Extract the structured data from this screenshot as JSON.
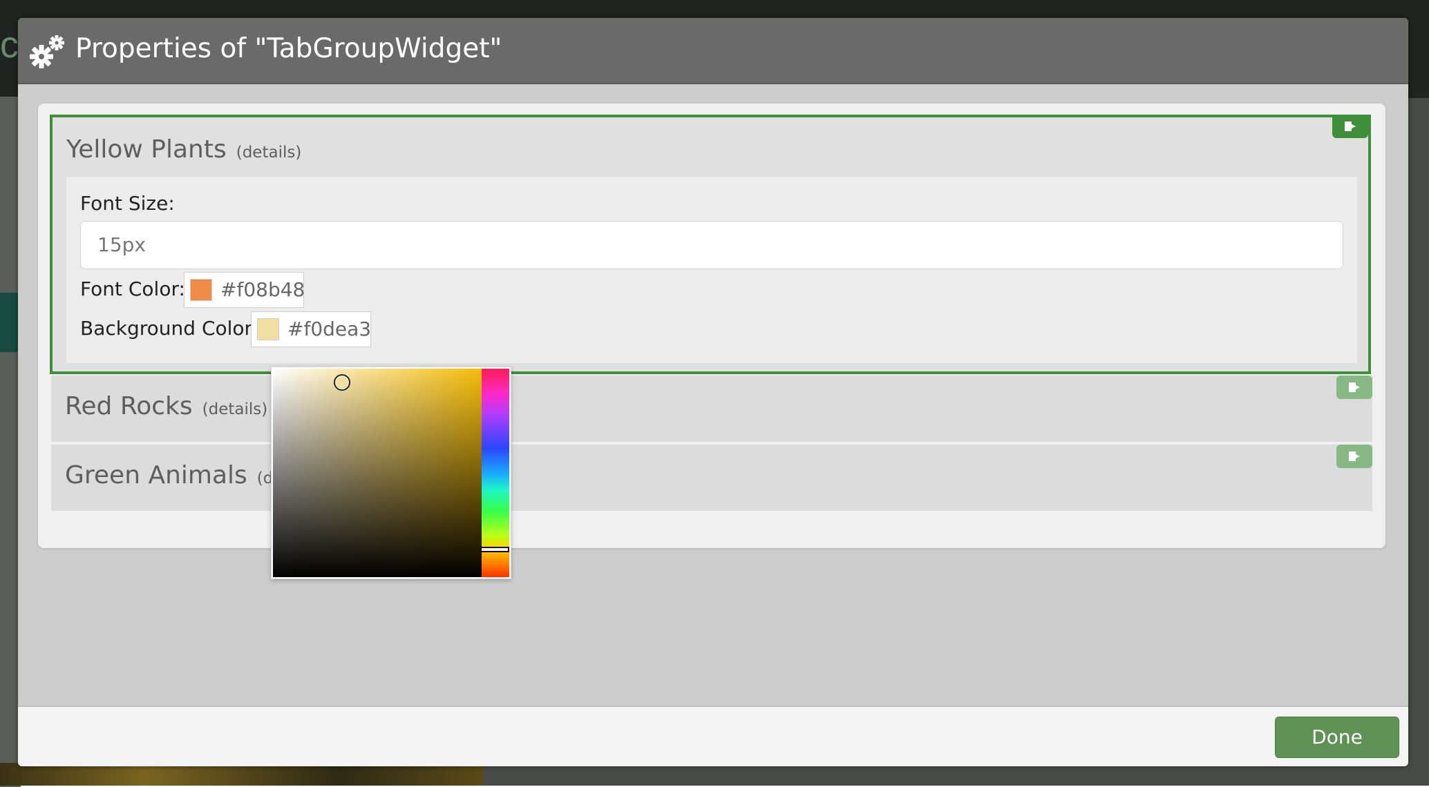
{
  "dialog": {
    "title": "Properties of \"TabGroupWidget\"",
    "icon": "gears-icon"
  },
  "tabs": [
    {
      "title": "Yellow Plants",
      "details_label": "(details)",
      "expanded": true,
      "properties": {
        "font_size_label": "Font Size",
        "font_size_value": "15px",
        "font_color_label": "Font Color",
        "font_color_value": "#f08b48",
        "background_color_label": "Background Color",
        "background_color_value": "#f0dea3"
      }
    },
    {
      "title": "Red Rocks",
      "details_label": "(details)",
      "expanded": false
    },
    {
      "title": "Green Animals",
      "details_label": "(details)",
      "expanded": false
    }
  ],
  "footer": {
    "done_label": "Done"
  },
  "colors": {
    "accent_green": "#3f8f3a",
    "done_button": "#5f9254",
    "header_bg": "#6a6a6a"
  }
}
